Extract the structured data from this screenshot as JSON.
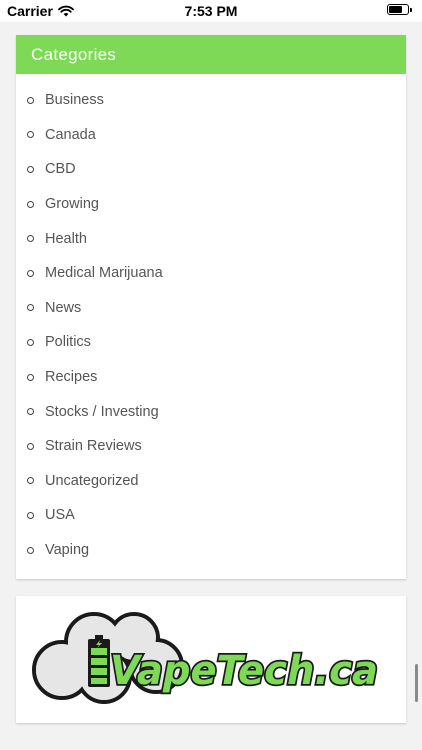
{
  "status_bar": {
    "carrier": "Carrier",
    "time": "7:53 PM"
  },
  "categories": {
    "title": "Categories",
    "items": [
      "Business",
      "Canada",
      "CBD",
      "Growing",
      "Health",
      "Medical Marijuana",
      "News",
      "Politics",
      "Recipes",
      "Stocks / Investing",
      "Strain Reviews",
      "Uncategorized",
      "USA",
      "Vaping"
    ]
  },
  "ad": {
    "logo_text": "VapeTech.ca",
    "colors": {
      "green": "#7ed957",
      "outline": "#1a1a1a"
    }
  },
  "colors": {
    "header_green": "#7ed957",
    "page_bg": "#f2f2f2"
  }
}
